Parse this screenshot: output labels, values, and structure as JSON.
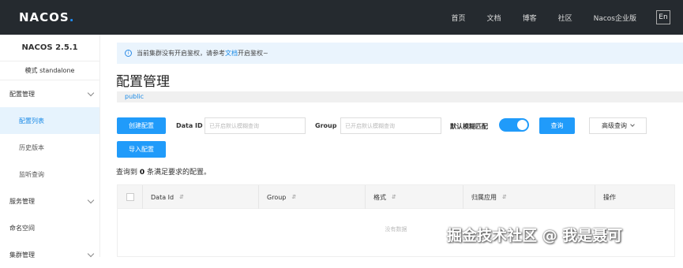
{
  "header": {
    "logo": "NACOS",
    "logo_dot": ".",
    "nav": [
      "首页",
      "文档",
      "博客",
      "社区",
      "Nacos企业版"
    ],
    "lang": "En"
  },
  "sidebar": {
    "version": "NACOS 2.5.1",
    "mode": "模式 standalone",
    "items": [
      {
        "label": "配置管理",
        "type": "group"
      },
      {
        "label": "配置列表",
        "type": "sub",
        "active": true
      },
      {
        "label": "历史版本",
        "type": "sub"
      },
      {
        "label": "监听查询",
        "type": "sub"
      },
      {
        "label": "服务管理",
        "type": "group"
      },
      {
        "label": "命名空间",
        "type": "item"
      },
      {
        "label": "集群管理",
        "type": "group"
      }
    ]
  },
  "alert": {
    "prefix": "当前集群没有开启鉴权，请参考",
    "link": "文档",
    "suffix": "开启鉴权~"
  },
  "page": {
    "title": "配置管理",
    "namespace": "public"
  },
  "toolbar": {
    "create_label": "创建配置",
    "import_label": "导入配置",
    "dataid_label": "Data ID",
    "dataid_placeholder": "已开启默认模糊查询",
    "group_label": "Group",
    "group_placeholder": "已开启默认模糊查询",
    "fuzzy_label": "默认模糊匹配",
    "fuzzy_on": true,
    "query_label": "查询",
    "advanced_label": "高级查询"
  },
  "result": {
    "prefix": "查询到",
    "count": "0",
    "suffix": "条满足要求的配置。"
  },
  "table": {
    "columns": [
      "Data Id",
      "Group",
      "格式",
      "归属应用",
      "操作"
    ],
    "empty": "没有数据"
  },
  "watermark": "掘金技术社区 @ 我是聂可",
  "colors": {
    "accent": "#209bfa",
    "header_bg": "#252a2f"
  }
}
